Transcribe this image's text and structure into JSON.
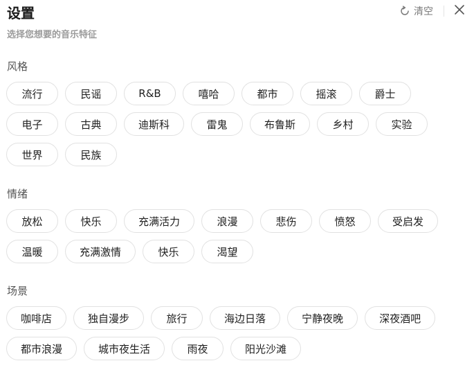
{
  "header": {
    "title": "设置",
    "clear_label": "清空"
  },
  "subtitle": "选择您想要的音乐特征",
  "sections": [
    {
      "title": "风格",
      "tags": [
        "流行",
        "民谣",
        "R&B",
        "嘻哈",
        "都市",
        "摇滚",
        "爵士",
        "电子",
        "古典",
        "迪斯科",
        "雷鬼",
        "布鲁斯",
        "乡村",
        "实验",
        "世界",
        "民族"
      ]
    },
    {
      "title": "情绪",
      "tags": [
        "放松",
        "快乐",
        "充满活力",
        "浪漫",
        "悲伤",
        "愤怒",
        "受启发",
        "温暖",
        "充满激情",
        "快乐",
        "渴望"
      ]
    },
    {
      "title": "场景",
      "tags": [
        "咖啡店",
        "独自漫步",
        "旅行",
        "海边日落",
        "宁静夜晚",
        "深夜酒吧",
        "都市浪漫",
        "城市夜生活",
        "雨夜",
        "阳光沙滩"
      ]
    }
  ],
  "icons": {
    "clear": "refresh-icon",
    "close": "close-icon"
  }
}
